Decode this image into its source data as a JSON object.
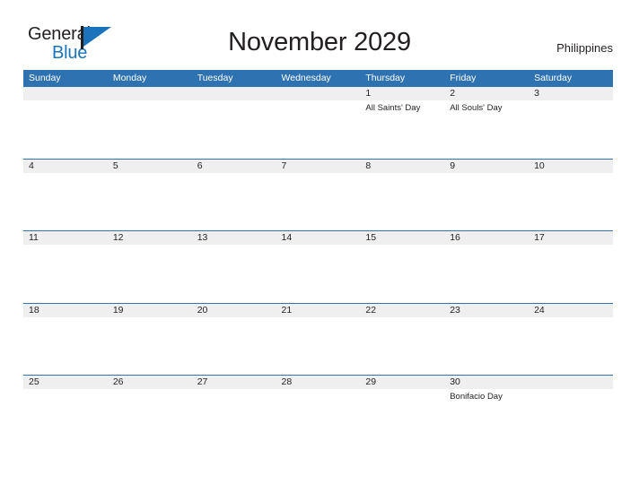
{
  "brand": {
    "name_part1": "General",
    "name_part2": "Blue",
    "logo_icon": "flag-triangle-icon",
    "accent_color": "#1b74bb"
  },
  "header": {
    "title": "November 2029",
    "country": "Philippines"
  },
  "colors": {
    "header_blue": "#2e72b2",
    "row_gray": "#efefef",
    "text": "#231f20"
  },
  "calendar": {
    "month": "November",
    "year": "2029",
    "weekday_headers": [
      "Sunday",
      "Monday",
      "Tuesday",
      "Wednesday",
      "Thursday",
      "Friday",
      "Saturday"
    ],
    "weeks": [
      {
        "dates": [
          "",
          "",
          "",
          "",
          "1",
          "2",
          "3"
        ],
        "events": [
          "",
          "",
          "",
          "",
          "All Saints' Day",
          "All Souls' Day",
          ""
        ]
      },
      {
        "dates": [
          "4",
          "5",
          "6",
          "7",
          "8",
          "9",
          "10"
        ],
        "events": [
          "",
          "",
          "",
          "",
          "",
          "",
          ""
        ]
      },
      {
        "dates": [
          "11",
          "12",
          "13",
          "14",
          "15",
          "16",
          "17"
        ],
        "events": [
          "",
          "",
          "",
          "",
          "",
          "",
          ""
        ]
      },
      {
        "dates": [
          "18",
          "19",
          "20",
          "21",
          "22",
          "23",
          "24"
        ],
        "events": [
          "",
          "",
          "",
          "",
          "",
          "",
          ""
        ]
      },
      {
        "dates": [
          "25",
          "26",
          "27",
          "28",
          "29",
          "30",
          ""
        ],
        "events": [
          "",
          "",
          "",
          "",
          "",
          "Bonifacio Day",
          ""
        ]
      }
    ]
  }
}
